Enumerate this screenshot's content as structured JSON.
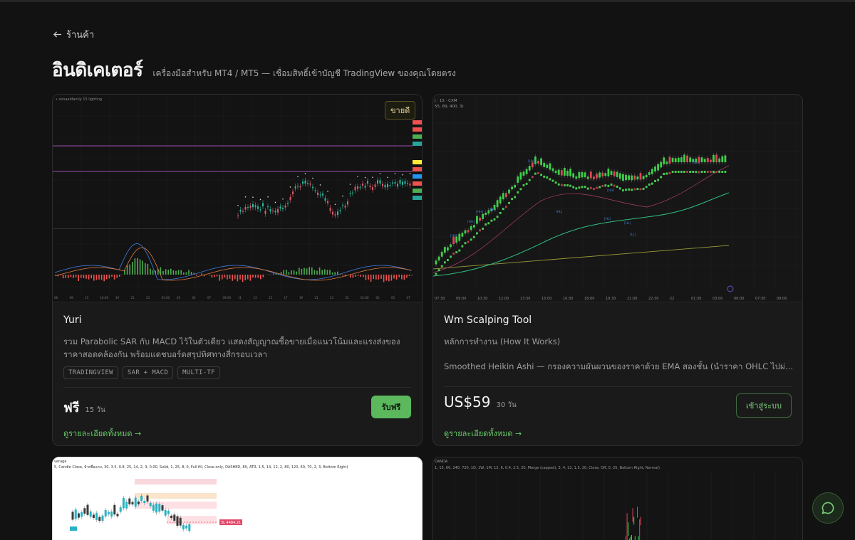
{
  "nav": {
    "back_label": "ร้านค้า"
  },
  "header": {
    "title": "อินดิเคเตอร์",
    "subtitle": "เครื่องมือสำหรับ MT4 / MT5 — เชื่อมสิทธิ์เข้าบัญชี TradingView ของคุณโดยตรง"
  },
  "cards": [
    {
      "title": "Yuri",
      "description": "รวม Parabolic SAR กับ MACD ไว้ในตัวเดียว แสดงสัญญาณซื้อขายเมื่อแนวโน้มและแรงส่งของราคาสอดคล้องกัน พร้อมแดชบอร์ดสรุปทิศทางสี่กรอบเวลา",
      "tags": [
        "TRADINGVIEW",
        "SAR + MACD",
        "MULTI-TF"
      ],
      "price": "ฟรี",
      "days": "15 วัน",
      "action_label": "รับฟรี",
      "detail_label": "ดูรายละเอียดทั้งหมด →",
      "chart_badge": "ขายดี",
      "chart_header": "• sonaabfamly 15 lighting",
      "chart_xticks": [
        "06",
        "09",
        "13",
        "16:00",
        "19",
        "21",
        "23",
        "01:00",
        "03",
        "05",
        "07",
        "09:00",
        "11",
        "13",
        "15",
        "17",
        "19",
        "21",
        "23",
        "25",
        "01:00",
        "03",
        "05",
        "07"
      ]
    },
    {
      "title": "Wm Scalping Tool",
      "description": "หลักการทำงาน (How It Works)",
      "description2": "Smoothed Heikin Ashi — กรองความผันผวนของราคาด้วย EMA สองชั้น (นำราคา OHLC ไปผ่าน EMA รอบแรก",
      "price": "US$59",
      "days": "30 วัน",
      "action_label": "เข้าสู่ระบบ",
      "detail_label": "ดูรายละเอียดทั้งหมด →",
      "chart_header": "J · 15 · CXM",
      "chart_header2": "55, 89, 400, 3)",
      "chart_xticks": [
        "07:30",
        "09:00",
        "10:30",
        "12:00",
        "13:30",
        "15:00",
        "16:30",
        "18:00",
        "19:30",
        "21:00",
        "22:30",
        "22",
        "01:30",
        "03:00",
        "06:00",
        "07:30",
        "09:00"
      ],
      "chart_labels": [
        "[HH]",
        "[HH]",
        "[HH]",
        "[HH]",
        "[HH]",
        "[HH]",
        "[HH]",
        "[HL]",
        "[HL]",
        "[HL]",
        "[LL]",
        "[LL]"
      ]
    },
    {
      "chart_header": "verage",
      "chart_header2": "5, Candle Close, ป้ายชื่อแถบ, 30, 3.5, 0.8, 25, 14, 2, 3, 0.00, Solid, 1, 25, 8, 0, Full fill, Close only, DASHED, 80, ATR, 1.5, 14, 12, 2, 80, 120, 60, 70, 2, 3, Bottom Right)",
      "chart_price_label": "3L 4484.21"
    },
    {
      "chart_header": "OANDA",
      "chart_header2": "1, 15, 60, 240, 720, 1D, 1W, 1M, 12, 6, 0.4, 2.5, 20, Merge (capped), 3, 4, 12, 1.5, 20, Close, Off, 0, 25, Bottom Right, Normal)"
    }
  ],
  "colors": {
    "accent": "#5cb85c",
    "background": "#121212",
    "card": "#1a1a1a"
  }
}
